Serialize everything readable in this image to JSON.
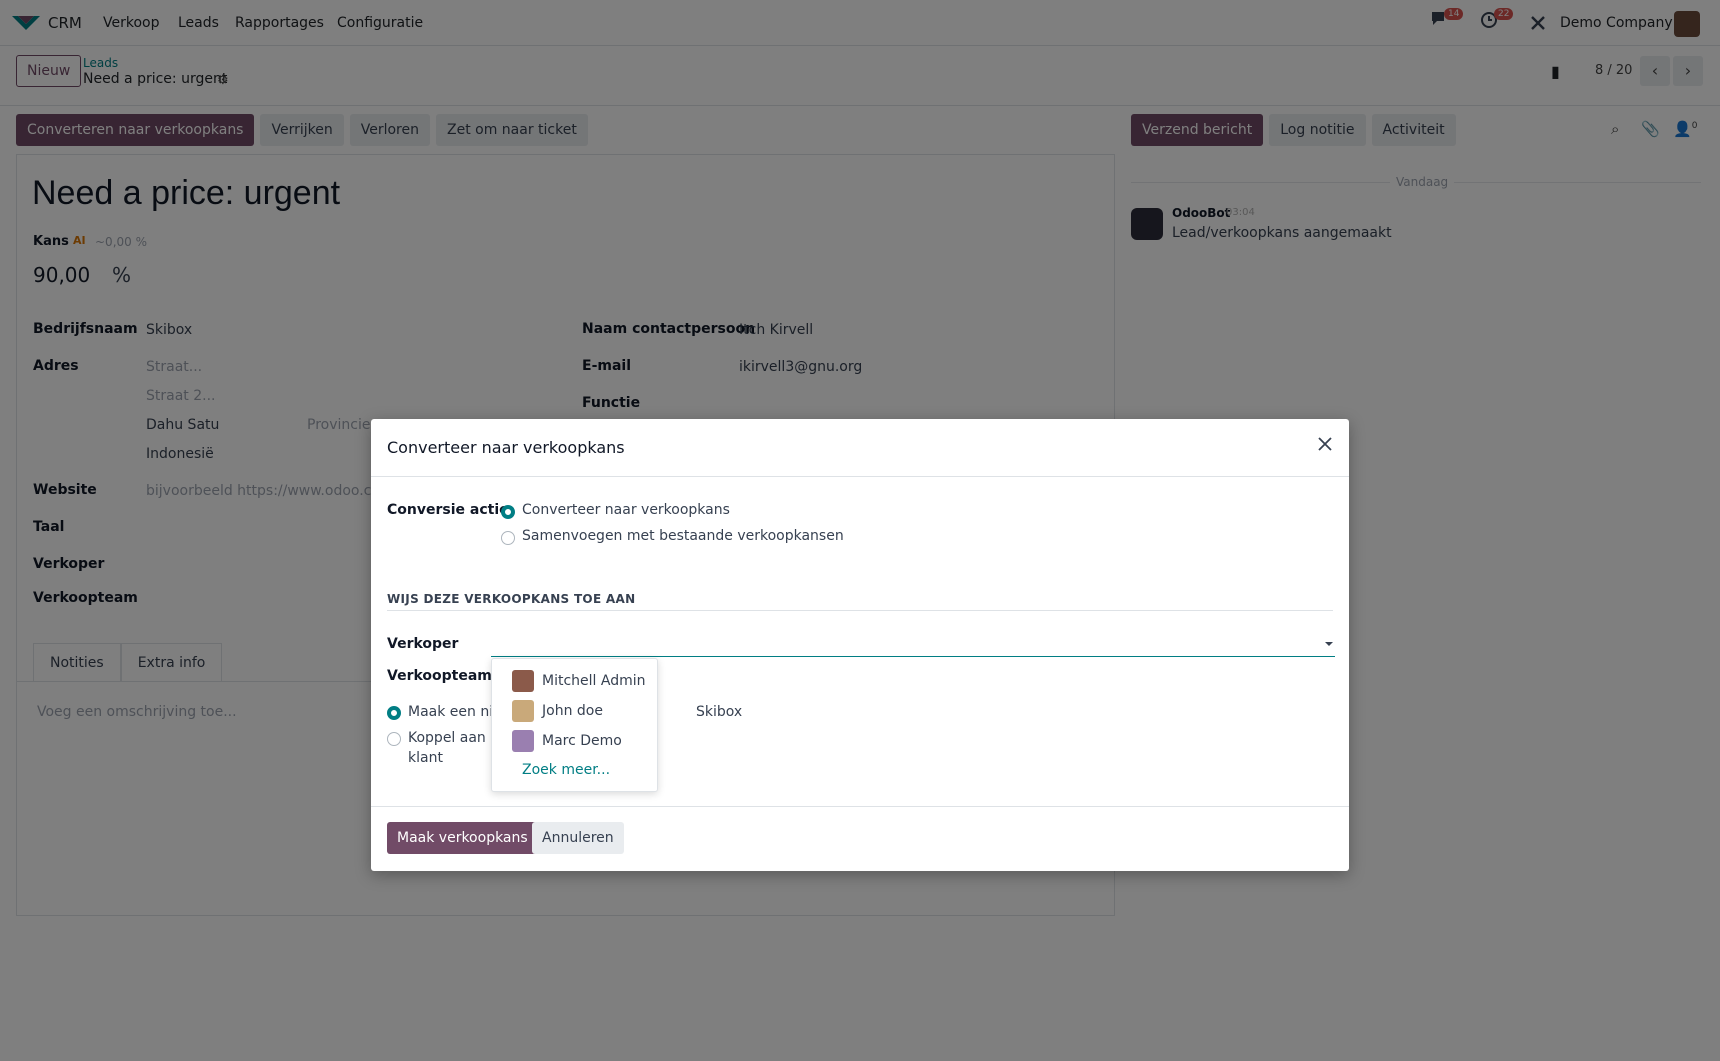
{
  "navbar": {
    "app_name": "CRM",
    "menu": [
      "Verkoop",
      "Leads",
      "Rapportages",
      "Configuratie"
    ],
    "messages_count": "14",
    "activities_count": "22",
    "company": "Demo Company"
  },
  "control_panel": {
    "new_button": "Nieuw",
    "breadcrumb_parent": "Leads",
    "breadcrumb_current": "Need a price: urgent",
    "pager": "8 / 20"
  },
  "actions": {
    "convert": "Converteren naar verkoopkans",
    "enrich": "Verrijken",
    "lost": "Verloren",
    "ticket": "Zet om naar ticket"
  },
  "form": {
    "title": "Need a price: urgent",
    "kans_label": "Kans",
    "kans_ai": "~0,00 %",
    "probability": "90,00",
    "percent": "%",
    "company_label": "Bedrijfsnaam",
    "company_value": "Skibox",
    "address_label": "Adres",
    "street_placeholder": "Straat...",
    "street2_placeholder": "Straat 2...",
    "city": "Dahu Satu",
    "state_placeholder": "Provincie",
    "country": "Indonesië",
    "website_label": "Website",
    "website_placeholder": "bijvoorbeeld https://www.odoo.com",
    "language_label": "Taal",
    "salesperson_label": "Verkoper",
    "salesteam_label": "Verkoopteam",
    "contact_label": "Naam contactpersoon",
    "contact_value": "Itch Kirvell",
    "email_label": "E-mail",
    "email_value": "ikirvell3@gnu.org",
    "function_label": "Functie",
    "tab_notes": "Notities",
    "tab_extra": "Extra info",
    "description_placeholder": "Voeg een omschrijving toe..."
  },
  "chatter": {
    "send_message": "Verzend bericht",
    "log_note": "Log notitie",
    "activity": "Activiteit",
    "followers_count": "0",
    "today": "Vandaag",
    "author": "OdooBot",
    "time": "03:04",
    "message": "Lead/verkoopkans aangemaakt"
  },
  "modal": {
    "title": "Converteer naar verkoopkans",
    "conversion_label": "Conversie actie",
    "option_convert": "Converteer naar verkoopkans",
    "option_merge": "Samenvoegen met bestaande verkoopkansen",
    "section_title": "WIJS DEZE VERKOOPKANS TOE AAN",
    "salesperson_label": "Verkoper",
    "salesteam_label": "Verkoopteam",
    "customer_option_new": "Maak een nie",
    "customer_option_link_1": "Koppel aan e",
    "customer_option_link_2": "klant",
    "customer_name": "Skibox",
    "create_button": "Maak verkoopkans",
    "cancel_button": "Annuleren"
  },
  "dropdown": {
    "options": [
      {
        "name": "Mitchell Admin",
        "color": "#8b5a4a"
      },
      {
        "name": "John doe",
        "color": "#c9a97a"
      },
      {
        "name": "Marc Demo",
        "color": "#9a7fb0"
      }
    ],
    "search_more": "Zoek meer..."
  },
  "colors": {
    "primary": "#714b67",
    "accent": "#017e84"
  }
}
